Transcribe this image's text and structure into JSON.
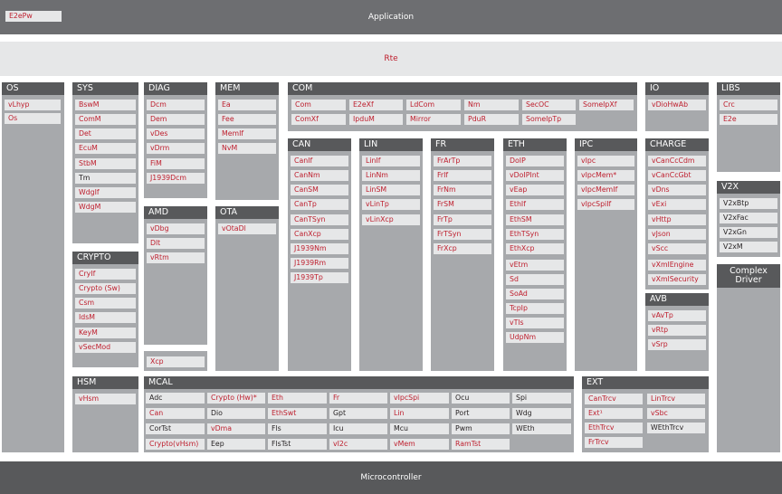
{
  "application": {
    "label": "Application",
    "e2epw": "E2ePw"
  },
  "rte": "Rte",
  "microcontroller": "Microcontroller",
  "colors": {
    "red": "#be1e2d",
    "dark": "#58595b",
    "panel": "#a7a9ac",
    "module": "#e6e7e8"
  },
  "os": {
    "title": "OS",
    "items": [
      "vLhyp",
      "Os"
    ]
  },
  "sys": {
    "title": "SYS",
    "items": [
      "BswM",
      "ComM",
      "Det",
      "EcuM",
      "StbM",
      "Tm",
      "WdgIf",
      "WdgM"
    ]
  },
  "crypto": {
    "title": "CRYPTO",
    "items": [
      "CryIf",
      "Crypto (Sw)",
      "Csm",
      "IdsM",
      "KeyM",
      "vSecMod"
    ]
  },
  "hsm": {
    "title": "HSM",
    "items": [
      "vHsm"
    ]
  },
  "diag": {
    "title": "DIAG",
    "items": [
      "Dcm",
      "Dem",
      "vDes",
      "vDrm",
      "FiM",
      "J1939Dcm"
    ]
  },
  "amd": {
    "title": "AMD",
    "items": [
      "vDbg",
      "Dlt",
      "vRtm"
    ]
  },
  "xcp": "Xcp",
  "mem": {
    "title": "MEM",
    "items": [
      "Ea",
      "Fee",
      "MemIf",
      "NvM"
    ]
  },
  "ota": {
    "title": "OTA",
    "items": [
      "vOtaDl"
    ]
  },
  "com": {
    "title": "COM",
    "row1": [
      "Com",
      "E2eXf",
      "LdCom",
      "Nm",
      "SecOC",
      "SomeIpXf"
    ],
    "row2": [
      "ComXf",
      "IpduM",
      "Mirror",
      "PduR",
      "SomeIpTp"
    ]
  },
  "can": {
    "title": "CAN",
    "items": [
      "CanIf",
      "CanNm",
      "CanSM",
      "CanTp",
      "CanTSyn",
      "CanXcp",
      "J1939Nm",
      "J1939Rm",
      "J1939Tp"
    ]
  },
  "lin": {
    "title": "LIN",
    "items": [
      "LinIf",
      "LinNm",
      "LinSM",
      "vLinTp",
      "vLinXcp"
    ]
  },
  "fr": {
    "title": "FR",
    "items": [
      "FrArTp",
      "FrIf",
      "FrNm",
      "FrSM",
      "FrTp",
      "FrTSyn",
      "FrXcp"
    ]
  },
  "eth": {
    "title": "ETH",
    "items": [
      "DoIP",
      "vDoIPInt",
      "vEap",
      "EthIf",
      "EthSM",
      "EthTSyn",
      "EthXcp",
      "vEtm",
      "Sd",
      "SoAd",
      "TcpIp",
      "vTls",
      "UdpNm"
    ]
  },
  "ipc": {
    "title": "IPC",
    "items": [
      "vIpc",
      "vIpcMem*",
      "vIpcMemIf",
      "vIpcSpiIf"
    ]
  },
  "io": {
    "title": "IO",
    "items": [
      "vDioHwAb"
    ]
  },
  "charge": {
    "title": "CHARGE",
    "items": [
      "vCanCcCdm",
      "vCanCcGbt",
      "vDns",
      "vExi",
      "vHttp",
      "vJson",
      "vScc",
      "vXmlEngine",
      "vXmlSecurity"
    ]
  },
  "avb": {
    "title": "AVB",
    "items": [
      "vAvTp",
      "vRtp",
      "vSrp"
    ]
  },
  "libs": {
    "title": "LIBS",
    "items": [
      "Crc",
      "E2e"
    ]
  },
  "v2x": {
    "title": "V2X",
    "items": [
      "V2xBtp",
      "V2xFac",
      "V2xGn",
      "V2xM"
    ]
  },
  "complex": {
    "line1": "Complex",
    "line2": "Driver"
  },
  "mcal": {
    "title": "MCAL",
    "rows": [
      [
        "Adc",
        "Crypto (Hw)*",
        "Eth",
        "Fr",
        "vIpcSpi",
        "Ocu",
        "Spi"
      ],
      [
        "Can",
        "Dio",
        "EthSwt",
        "Gpt",
        "Lin",
        "Port",
        "Wdg"
      ],
      [
        "CorTst",
        "vDma",
        "Fls",
        "Icu",
        "Mcu",
        "Pwm",
        "WEth"
      ],
      [
        "Crypto(vHsm)",
        "Eep",
        "FlsTst",
        "vI2c",
        "vMem",
        "RamTst",
        ""
      ]
    ]
  },
  "ext": {
    "title": "EXT",
    "col1": [
      "CanTrcv",
      "Ext¹",
      "EthTrcv",
      "FrTrcv"
    ],
    "col2": [
      "LinTrcv",
      "vSbc",
      "WEthTrcv"
    ]
  }
}
